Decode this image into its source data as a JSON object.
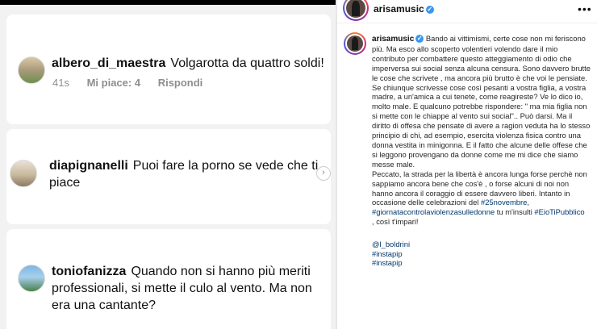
{
  "comments": [
    {
      "username": "albero_di_maestra",
      "text": "Volgarotta da quattro soldi!",
      "time": "41s",
      "likes": "Mi piace: 4",
      "reply": "Rispondi"
    },
    {
      "username": "diapignanelli",
      "text": "Puoi fare la porno se vede che ti piace"
    },
    {
      "username": "toniofanizza",
      "text": "Quando non si hanno più meriti professionali, si mette il culo al vento. Ma non era una cantante?"
    }
  ],
  "post": {
    "username": "arisamusic",
    "caption_lines": [
      "Bando ai vittimismi, certe cose non mi feriscono",
      "più. Ma esco allo scoperto volentieri volendo dare il mio",
      "contributo per combattere questo atteggiamento di odio che",
      "imperversa sui social senza alcuna censura. Sono davvero brutte",
      "le cose che scrivete , ma ancora più brutto è che voi le pensiate.",
      "Se chiunque scrivesse cose così pesanti a vostra figlia, a vostra",
      "madre, a un'amica a cui tenete, come reagireste? Ve lo dico io,",
      "molto male. E qualcuno potrebbe rispondere: \" ma mia figlia non",
      "si mette con le chiappe al vento sui social\".. Può darsi. Ma il",
      "diritto di offesa che pensate di avere a ragion veduta ha lo stesso",
      "principio di chi, ad esempio, esercita violenza fisica contro una",
      "donna vestita in minigonna. E il fatto che alcune delle offese che",
      "si leggono provengano da donne come me mi dice che siamo",
      "messe male.",
      "Peccato, la strada per la libertà è ancora lunga forse perchè non",
      "sappiamo ancora bene che cos'è , o forse alcuni di noi non",
      "hanno ancora il coraggio di essere davvero liberi. Intanto in",
      "occasione delle celebrazioni del"
    ],
    "hashtag_1": "#25novembre",
    "comma_1": ",",
    "hashtag_2": "#giornatacontrolaviolenzasulledonne",
    "text_mid": " tu m'insulti ",
    "hashtag_3": "#EioTiPubblico",
    "text_end": ", così t'impari!",
    "mentions": [
      "@l_boldrini",
      "#instapip",
      "#instapip"
    ]
  },
  "colors": {
    "link": "#00376b",
    "verified": "#3897f0",
    "meta": "#8e8e8e"
  }
}
